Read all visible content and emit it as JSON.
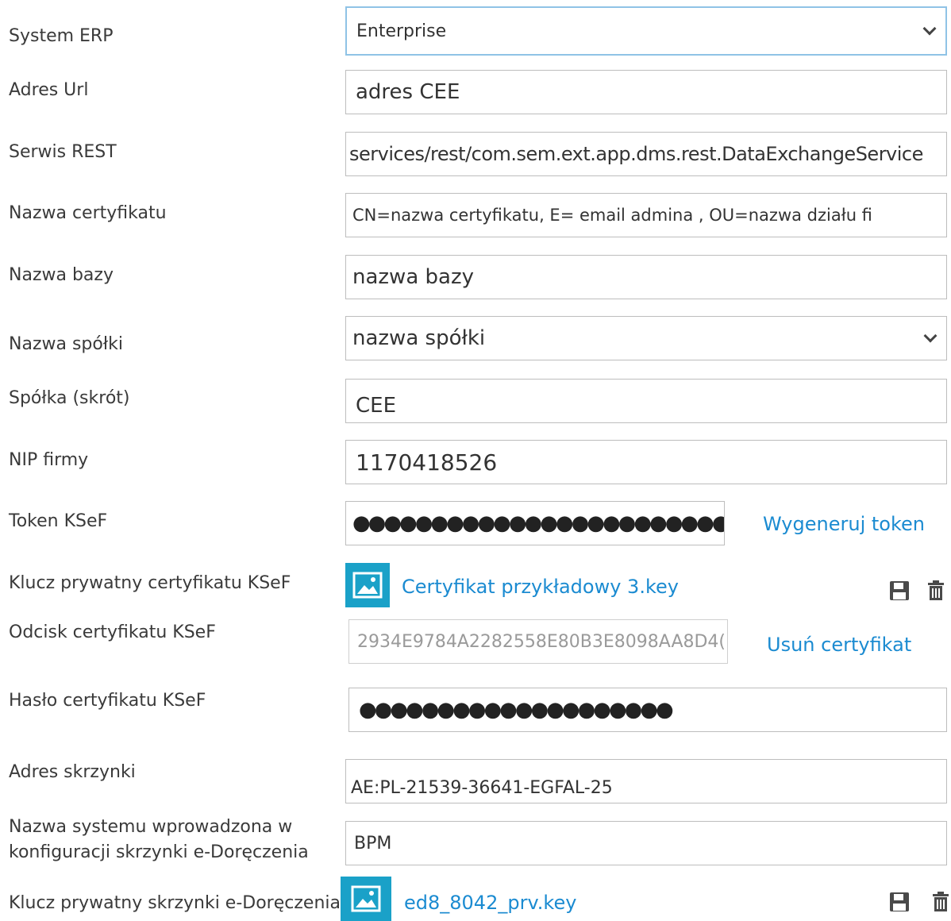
{
  "form": {
    "system_erp": {
      "label": "System ERP",
      "value": "Enterprise"
    },
    "adres_url": {
      "label": "Adres Url",
      "value": "adres CEE"
    },
    "serwis_rest": {
      "label": "Serwis REST",
      "value": "services/rest/com.sem.ext.app.dms.rest.DataExchangeService"
    },
    "nazwa_certyfikatu": {
      "label": "Nazwa certyfikatu",
      "value": "CN=nazwa certyfikatu, E= email admina , OU=nazwa działu fi"
    },
    "nazwa_bazy": {
      "label": "Nazwa bazy",
      "value": "nazwa bazy"
    },
    "nazwa_spolki": {
      "label": "Nazwa spółki",
      "value": "nazwa spółki"
    },
    "spolka_skrot": {
      "label": "Spółka (skrót)",
      "value": "CEE"
    },
    "nip_firmy": {
      "label": "NIP firmy",
      "value": "1170418526"
    },
    "token_ksef": {
      "label": "Token KSeF",
      "value": "●●●●●●●●●●●●●●●●●●●●●●●●●●●●●●●●●●●",
      "action": "Wygeneruj token"
    },
    "klucz_ksef": {
      "label": "Klucz prywatny certyfikatu KSeF",
      "file": "Certyfikat przykładowy 3.key"
    },
    "odcisk_ksef": {
      "label": "Odcisk certyfikatu KSeF",
      "value": "2934E9784A2282558E80B3E8098AA8D4(",
      "action": "Usuń certyfikat"
    },
    "haslo_ksef": {
      "label": "Hasło certyfikatu KSeF",
      "value": "●●●●●●●●●●●●●●●●●●●●"
    },
    "adres_skrzynki": {
      "label": "Adres skrzynki",
      "value": "AE:PL-21539-36641-EGFAL-25"
    },
    "nazwa_systemu": {
      "label_line1": "Nazwa systemu wprowadzona w",
      "label_line2": "konfiguracji skrzynki e-Doręczenia",
      "value": "BPM"
    },
    "klucz_skrzynki": {
      "label": "Klucz prywatny skrzynki e-Doręczenia",
      "file": "ed8_8042_prv.key"
    }
  },
  "icons": {
    "file_icon": "image-file-icon",
    "save_icon": "floppy-disk-icon",
    "delete_icon": "trash-icon",
    "accent_color": "#1aa1c8",
    "link_color": "#1b8bd1"
  }
}
